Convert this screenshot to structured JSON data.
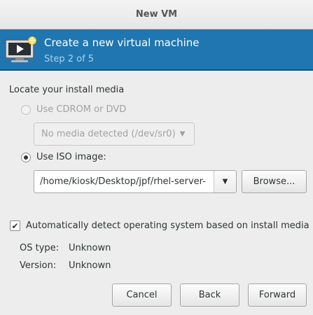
{
  "window": {
    "title": "New VM"
  },
  "banner": {
    "icon": "monitor-play-icon",
    "title": "Create a new virtual machine",
    "step": "Step 2 of 5"
  },
  "install_media": {
    "section_label": "Locate your install media",
    "cdrom_label": "Use CDROM or DVD",
    "cdrom_combo_value": "No media detected (/dev/sr0)",
    "iso_label": "Use ISO image:",
    "iso_path": "/home/kiosk/Desktop/jpf/rhel-server-",
    "browse_label": "Browse..."
  },
  "os_detect": {
    "checkbox_label": "Automatically detect operating system based on install media",
    "checked": true,
    "os_type_label": "OS type:",
    "os_type_value": "Unknown",
    "version_label": "Version:",
    "version_value": "Unknown"
  },
  "buttons": {
    "cancel": "Cancel",
    "back": "Back",
    "forward": "Forward"
  },
  "colors": {
    "banner_bg": "#1f76b0",
    "banner_step_text": "#a9d4f1"
  }
}
